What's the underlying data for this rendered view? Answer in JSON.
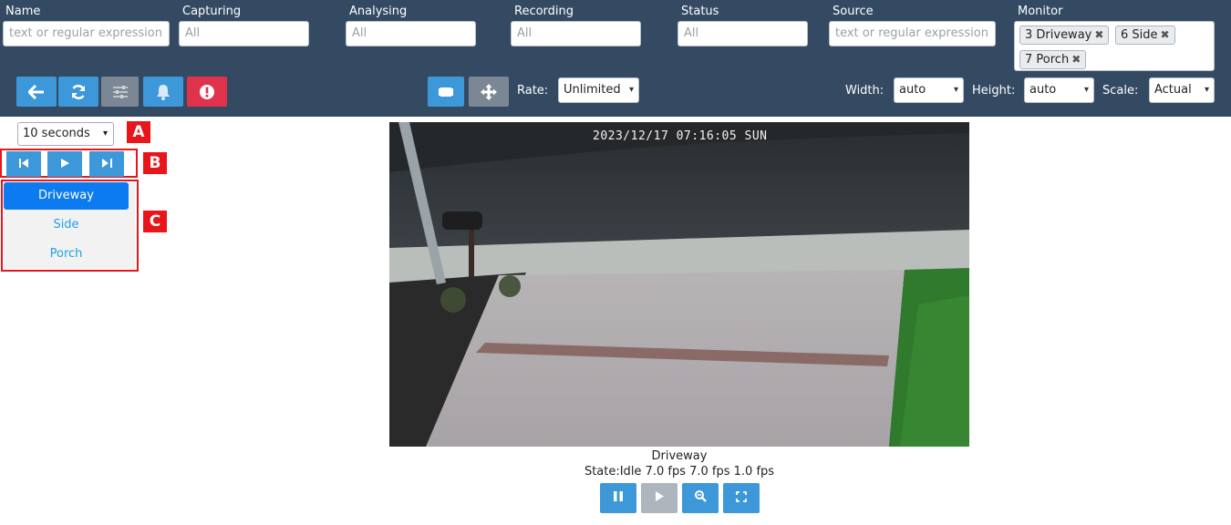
{
  "filters": {
    "name": {
      "label": "Name",
      "placeholder": "text or regular expression"
    },
    "capturing": {
      "label": "Capturing",
      "value": "All"
    },
    "analysing": {
      "label": "Analysing",
      "value": "All"
    },
    "recording": {
      "label": "Recording",
      "value": "All"
    },
    "status": {
      "label": "Status",
      "value": "All"
    },
    "source": {
      "label": "Source",
      "placeholder": "text or regular expression"
    },
    "monitor": {
      "label": "Monitor",
      "chips": [
        "3 Driveway",
        "6 Side",
        "7 Porch"
      ]
    }
  },
  "toolbar": {
    "icons": [
      "back-arrow-icon",
      "refresh-icon",
      "sliders-icon",
      "bell-icon",
      "alert-icon",
      "film-icon",
      "move-arrows-icon"
    ],
    "rate_label": "Rate:",
    "rate_value": "Unlimited",
    "width_label": "Width:",
    "width_value": "auto",
    "height_label": "Height:",
    "height_value": "auto",
    "scale_label": "Scale:",
    "scale_value": "Actual"
  },
  "cycle": {
    "interval": "10 seconds",
    "markers": [
      "A",
      "B",
      "C"
    ],
    "monitors": [
      "Driveway",
      "Side",
      "Porch"
    ],
    "active": "Driveway"
  },
  "video": {
    "timestamp": "2023/12/17 07:16:05 SUN",
    "monitor_name": "Driveway",
    "state": "State:Idle 7.0 fps 7.0 fps 1.0 fps"
  },
  "colors": {
    "topbar": "#344a62",
    "button_blue": "#3d98d9",
    "button_gray": "#7b8794",
    "button_red": "#e0334b",
    "active_item": "#0d7bf0",
    "item_link": "#1fa3e0",
    "marker_red": "#e8151b"
  }
}
